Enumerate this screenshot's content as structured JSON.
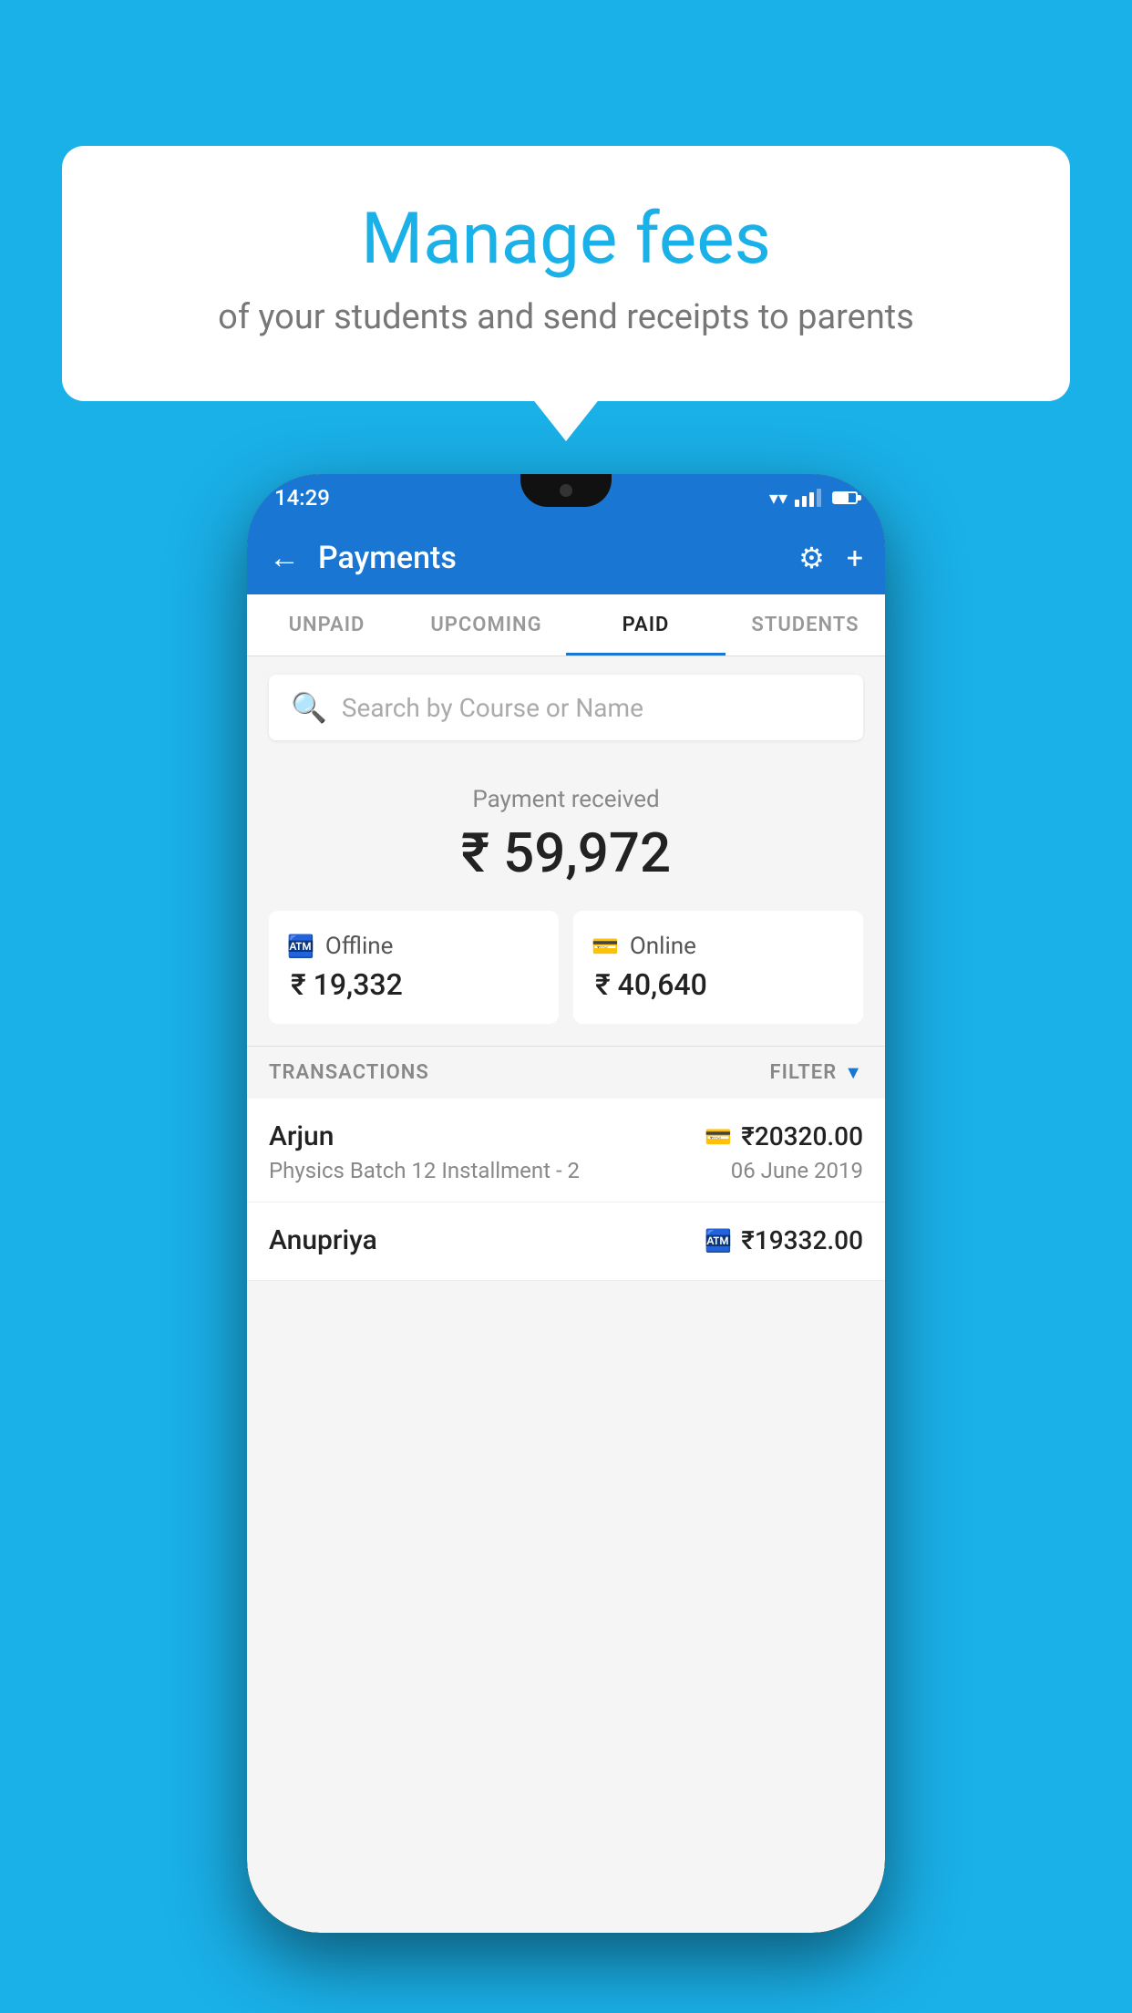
{
  "background_color": "#1ab0e8",
  "bubble": {
    "title": "Manage fees",
    "subtitle": "of your students and send receipts to parents"
  },
  "phone": {
    "status_bar": {
      "time": "14:29"
    },
    "header": {
      "title": "Payments",
      "back_label": "←",
      "settings_label": "⚙",
      "add_label": "+"
    },
    "tabs": [
      {
        "label": "UNPAID",
        "active": false
      },
      {
        "label": "UPCOMING",
        "active": false
      },
      {
        "label": "PAID",
        "active": true
      },
      {
        "label": "STUDENTS",
        "active": false
      }
    ],
    "search": {
      "placeholder": "Search by Course or Name"
    },
    "payment_summary": {
      "label": "Payment received",
      "total": "₹ 59,972",
      "offline": {
        "label": "Offline",
        "amount": "₹ 19,332"
      },
      "online": {
        "label": "Online",
        "amount": "₹ 40,640"
      }
    },
    "transactions_section": {
      "label": "TRANSACTIONS",
      "filter_label": "FILTER"
    },
    "transactions": [
      {
        "name": "Arjun",
        "amount": "₹20320.00",
        "course": "Physics Batch 12 Installment - 2",
        "date": "06 June 2019",
        "payment_type": "online"
      },
      {
        "name": "Anupriya",
        "amount": "₹19332.00",
        "course": "",
        "date": "",
        "payment_type": "offline"
      }
    ]
  }
}
